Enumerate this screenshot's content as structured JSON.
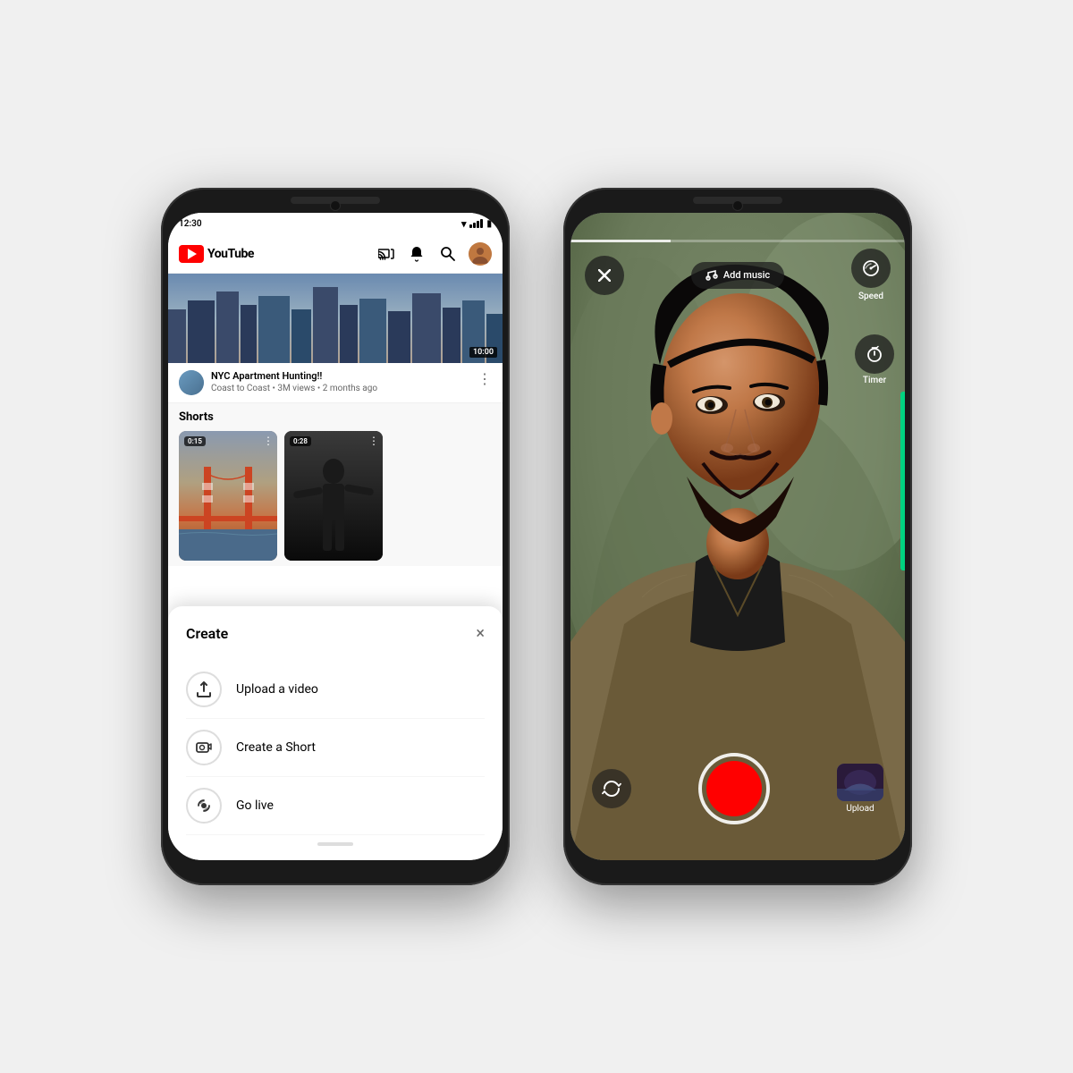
{
  "phone_left": {
    "status_bar": {
      "time": "12:30",
      "wifi": "▾",
      "signal": "▲",
      "battery": "▪"
    },
    "header": {
      "logo_text": "YouTube",
      "icons": [
        "cast",
        "notifications",
        "search",
        "avatar"
      ]
    },
    "video": {
      "duration": "10:00",
      "title": "NYC Apartment Hunting!!",
      "subtitle": "Coast to Coast • 3M views • 2 months ago"
    },
    "shorts": {
      "section_title": "Shorts",
      "items": [
        {
          "duration": "0:15"
        },
        {
          "duration": "0:28"
        }
      ]
    },
    "create_modal": {
      "title": "Create",
      "close_label": "×",
      "items": [
        {
          "label": "Upload a video",
          "icon": "upload"
        },
        {
          "label": "Create a Short",
          "icon": "camera"
        },
        {
          "label": "Go live",
          "icon": "broadcast"
        }
      ]
    }
  },
  "phone_right": {
    "top_controls": {
      "close_label": "×",
      "add_music_label": "Add music",
      "speed_label": "Speed",
      "timer_label": "Timer"
    },
    "bottom_controls": {
      "upload_label": "Upload",
      "flip_icon": "↺"
    }
  }
}
